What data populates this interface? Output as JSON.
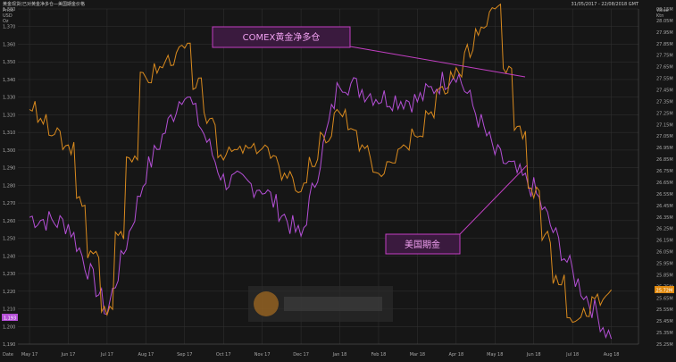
{
  "header": {
    "title": "黄金现货(已对黄金净多仓—美国期金价格",
    "timestamp": "31/05/2017 - 22/08/2018 GMT"
  },
  "axes": {
    "left_title_line1": "Price",
    "left_title_line2": "USD",
    "left_title_line3": "Oz",
    "right_title_line1": "Value",
    "right_title_line2": "Ktn",
    "left_ticks": [
      "1,380",
      "1,370",
      "1,360",
      "1,350",
      "1,340",
      "1,330",
      "1,320",
      "1,310",
      "1,300",
      "1,290",
      "1,280",
      "1,270",
      "1,260",
      "1,250",
      "1,240",
      "1,230",
      "1,220",
      "1,210",
      "1,200",
      "1,190"
    ],
    "right_ticks": [
      "28.15M",
      "28.05M",
      "27.95M",
      "27.85M",
      "27.75M",
      "27.65M",
      "27.55M",
      "27.45M",
      "27.35M",
      "27.25M",
      "27.15M",
      "27.05M",
      "26.95M",
      "26.85M",
      "26.75M",
      "26.65M",
      "26.55M",
      "26.45M",
      "26.35M",
      "26.25M",
      "26.15M",
      "26.05M",
      "25.95M",
      "25.85M",
      "25.75M",
      "25.65M",
      "25.55M",
      "25.45M",
      "25.35M",
      "25.25M"
    ],
    "x_month_labels": [
      "May 17",
      "Jun 17",
      "Jul 17",
      "Aug 17",
      "Sep 17",
      "Oct 17",
      "Nov 17",
      "Dec 17",
      "Jan 18",
      "Feb 18",
      "Mar 18",
      "Apr 18",
      "May 18",
      "Jun 18",
      "Jul 18",
      "Aug 18"
    ],
    "x_label": "Date",
    "left_last_value": "1,193",
    "right_last_value": "25.72M"
  },
  "annotations": {
    "comex_label": "COMEX黄金净多仓",
    "futures_label": "美国期金"
  },
  "colors": {
    "background": "#161616",
    "grid": "#333333",
    "gold_futures_line": "#b44fd6",
    "comex_line": "#d98a1e",
    "annotation_border": "#c23fc2",
    "annotation_fill": "#3a1a3e",
    "annotation_text": "#f0a0f0",
    "left_badge": "#b44fd6",
    "right_badge": "#e08a10"
  },
  "chart_data": {
    "type": "line",
    "x": [
      "2017-05",
      "2017-06",
      "2017-07",
      "2017-08",
      "2017-09",
      "2017-10",
      "2017-11",
      "2017-12",
      "2018-01",
      "2018-02",
      "2018-03",
      "2018-04",
      "2018-05",
      "2018-06",
      "2018-07",
      "2018-08"
    ],
    "series": [
      {
        "name": "美国期金",
        "axis": "left",
        "values": [
          1262,
          1258,
          1208,
          1287,
          1335,
          1283,
          1279,
          1250,
          1340,
          1330,
          1328,
          1345,
          1298,
          1278,
          1230,
          1193
        ]
      },
      {
        "name": "COMEX黄金净多仓",
        "axis": "right",
        "values": [
          27.3,
          26.95,
          25.55,
          27.55,
          27.8,
          26.9,
          26.95,
          26.6,
          27.25,
          26.75,
          27.1,
          27.6,
          28.15,
          26.55,
          25.45,
          25.72
        ]
      }
    ]
  }
}
